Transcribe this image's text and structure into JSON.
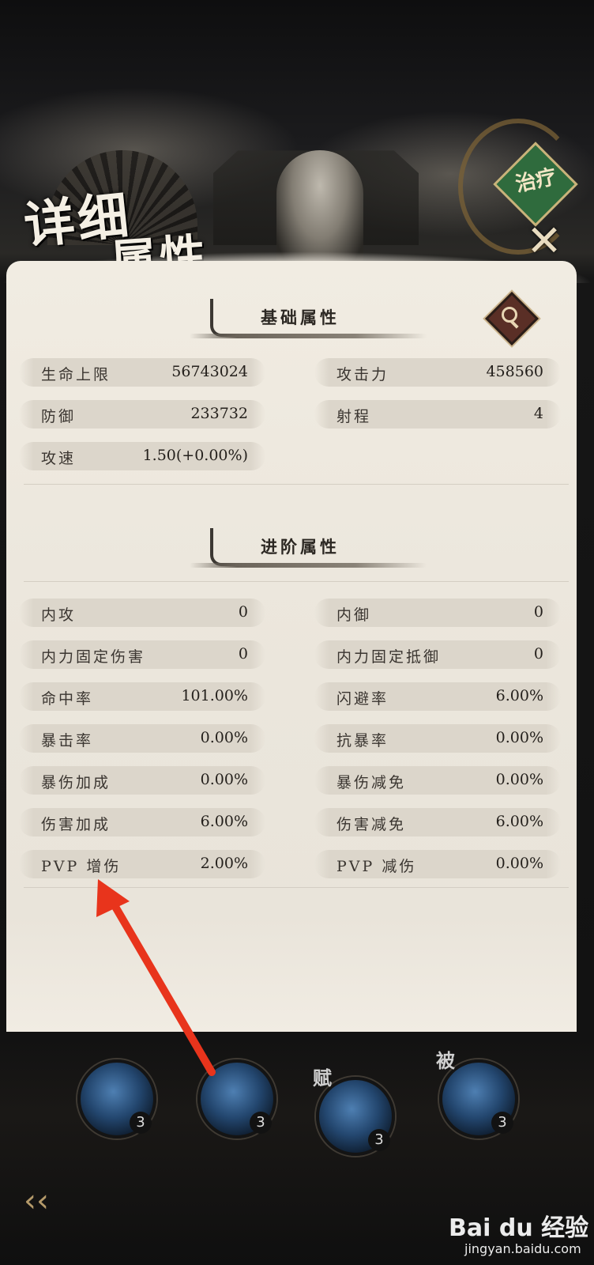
{
  "header": {
    "title_line1": "详细",
    "title_line2": "属性",
    "class_badge": "治疗"
  },
  "basic": {
    "heading": "基础属性",
    "stats": [
      {
        "label": "生命上限",
        "value": "56743024"
      },
      {
        "label": "攻击力",
        "value": "458560"
      },
      {
        "label": "防御",
        "value": "233732"
      },
      {
        "label": "射程",
        "value": "4"
      },
      {
        "label": "攻速",
        "value": "1.50(+0.00%)"
      }
    ]
  },
  "advanced": {
    "heading": "进阶属性",
    "stats": [
      {
        "label": "内攻",
        "value": "0"
      },
      {
        "label": "内御",
        "value": "0"
      },
      {
        "label": "内力固定伤害",
        "value": "0"
      },
      {
        "label": "内力固定抵御",
        "value": "0"
      },
      {
        "label": "命中率",
        "value": "101.00%"
      },
      {
        "label": "闪避率",
        "value": "6.00%"
      },
      {
        "label": "暴击率",
        "value": "0.00%"
      },
      {
        "label": "抗暴率",
        "value": "0.00%"
      },
      {
        "label": "暴伤加成",
        "value": "0.00%"
      },
      {
        "label": "暴伤减免",
        "value": "0.00%"
      },
      {
        "label": "伤害加成",
        "value": "6.00%"
      },
      {
        "label": "伤害减免",
        "value": "6.00%"
      },
      {
        "label": "PVP 增伤",
        "value": "2.00%"
      },
      {
        "label": "PVP 减伤",
        "value": "0.00%"
      }
    ]
  },
  "skills": [
    {
      "tag": "",
      "level": "3"
    },
    {
      "tag": "",
      "level": "3"
    },
    {
      "tag": "赋",
      "level": "3"
    },
    {
      "tag": "被",
      "level": "3"
    }
  ],
  "icons": {
    "close": "close-icon",
    "search": "magnifier-icon",
    "back": "back-arrow-icon"
  },
  "watermark": {
    "brand": "Bai du 经验",
    "url": "jingyan.baidu.com"
  },
  "colors": {
    "panel": "#ece7dd",
    "row": "#dcd6cb",
    "badge": "#2f6b3d",
    "annotation_arrow": "#e8341c"
  }
}
